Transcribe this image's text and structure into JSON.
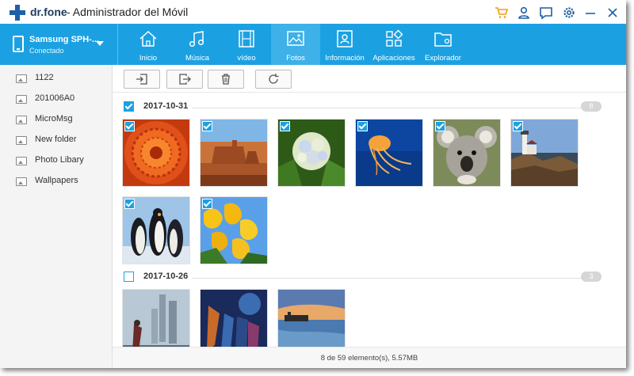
{
  "window": {
    "brand": "dr.fone",
    "title": "- Administrador del Móvil"
  },
  "titlebar_icons": [
    "cart-icon",
    "user-icon",
    "feedback-icon",
    "settings-icon",
    "minimize-icon",
    "close-icon"
  ],
  "device": {
    "name": "Samsung SPH-...",
    "status": "Conectado"
  },
  "nav": {
    "tabs": [
      {
        "label": "Inicio",
        "icon": "home-icon"
      },
      {
        "label": "Música",
        "icon": "music-icon"
      },
      {
        "label": "vídeo",
        "icon": "video-icon"
      },
      {
        "label": "Fotos",
        "icon": "photo-icon",
        "active": true
      },
      {
        "label": "Información",
        "icon": "contact-icon"
      },
      {
        "label": "Aplicaciones",
        "icon": "apps-icon"
      },
      {
        "label": "Explorador",
        "icon": "folder-icon"
      }
    ]
  },
  "sidebar": {
    "items": [
      {
        "label": "1122"
      },
      {
        "label": "201006A0"
      },
      {
        "label": "MicroMsg"
      },
      {
        "label": "New folder"
      },
      {
        "label": "Photo Libary"
      },
      {
        "label": "Wallpapers"
      }
    ]
  },
  "toolbar": {
    "buttons": [
      "import-icon",
      "export-icon",
      "delete-icon",
      "refresh-icon"
    ]
  },
  "groups": [
    {
      "date": "2017-10-31",
      "count": "8",
      "checked": true,
      "photos": [
        "orange-flower",
        "desert-mesa",
        "hydrangea",
        "jellyfish",
        "koala",
        "lighthouse",
        "penguins",
        "tulips"
      ]
    },
    {
      "date": "2017-10-26",
      "count": "3",
      "checked": false,
      "photos": [
        "fantasy-castle",
        "fantasy-warriors",
        "seaside-sunset"
      ]
    }
  ],
  "status": {
    "text": "8 de 59 elemento(s), 5.57MB"
  },
  "colors": {
    "accent": "#1ba1e2",
    "nav_active": "#3db1e8",
    "cart": "#f39c12"
  }
}
